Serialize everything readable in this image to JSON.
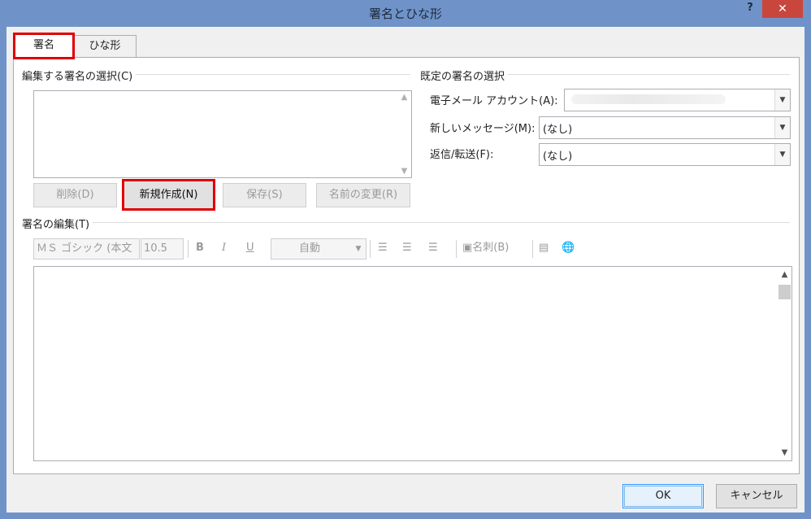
{
  "window": {
    "title": "署名とひな形",
    "help_label": "?",
    "close_label": "✕"
  },
  "tabs": [
    {
      "label": "署名",
      "active": true
    },
    {
      "label": "ひな形",
      "active": false
    }
  ],
  "select_signature": {
    "label": "編集する署名の選択(C)",
    "buttons": {
      "delete": "削除(D)",
      "new": "新規作成(N)",
      "save": "保存(S)",
      "rename": "名前の変更(R)"
    }
  },
  "default_signature": {
    "label": "既定の署名の選択",
    "email_account": {
      "label": "電子メール アカウント(A):",
      "value": ""
    },
    "new_messages": {
      "label": "新しいメッセージ(M):",
      "value": "(なし)"
    },
    "replies": {
      "label": "返信/転送(F):",
      "value": "(なし)"
    }
  },
  "edit_signature": {
    "label": "署名の編集(T)",
    "toolbar": {
      "font": "ＭＳ ゴシック (本文",
      "size": "10.5",
      "bold": "B",
      "italic": "I",
      "underline": "U",
      "color": "自動",
      "business_card": "名刺(B)"
    }
  },
  "footer": {
    "ok": "OK",
    "cancel": "キャンセル"
  },
  "colors": {
    "title_bar": "#6f93c9",
    "close": "#c9463d",
    "highlight": "#e00000"
  }
}
